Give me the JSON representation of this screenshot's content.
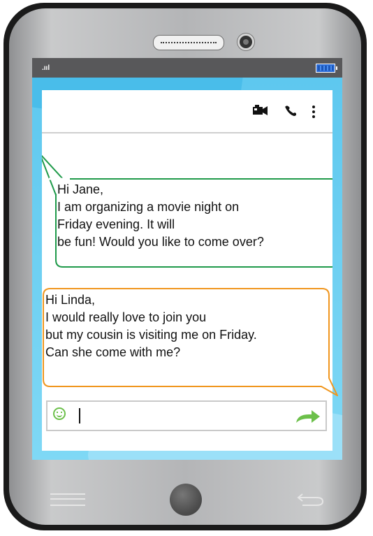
{
  "status_bar": {
    "signal": ".ııl",
    "battery": "full"
  },
  "header": {
    "icons": [
      "video-camera-icon",
      "phone-icon",
      "more-vertical-icon"
    ]
  },
  "messages": [
    {
      "sender": "incoming",
      "border_color": "#1f9a4a",
      "lines": [
        "Hi Jane,",
        "I am organizing a movie night on",
        "Friday evening. It will",
        "be fun! Would you like to come over?"
      ]
    },
    {
      "sender": "outgoing",
      "border_color": "#f0961e",
      "lines": [
        "Hi Linda,",
        "I would really love to join you",
        "but my cousin is visiting me on Friday.",
        "Can she come with me?"
      ]
    }
  ],
  "composer": {
    "value": "",
    "emoji_icon": "smiley-icon",
    "send_icon": "send-arrow-icon",
    "send_color": "#6cc04a"
  },
  "nav_bar": {
    "icons": [
      "menu-icon",
      "home-button",
      "back-icon"
    ]
  }
}
